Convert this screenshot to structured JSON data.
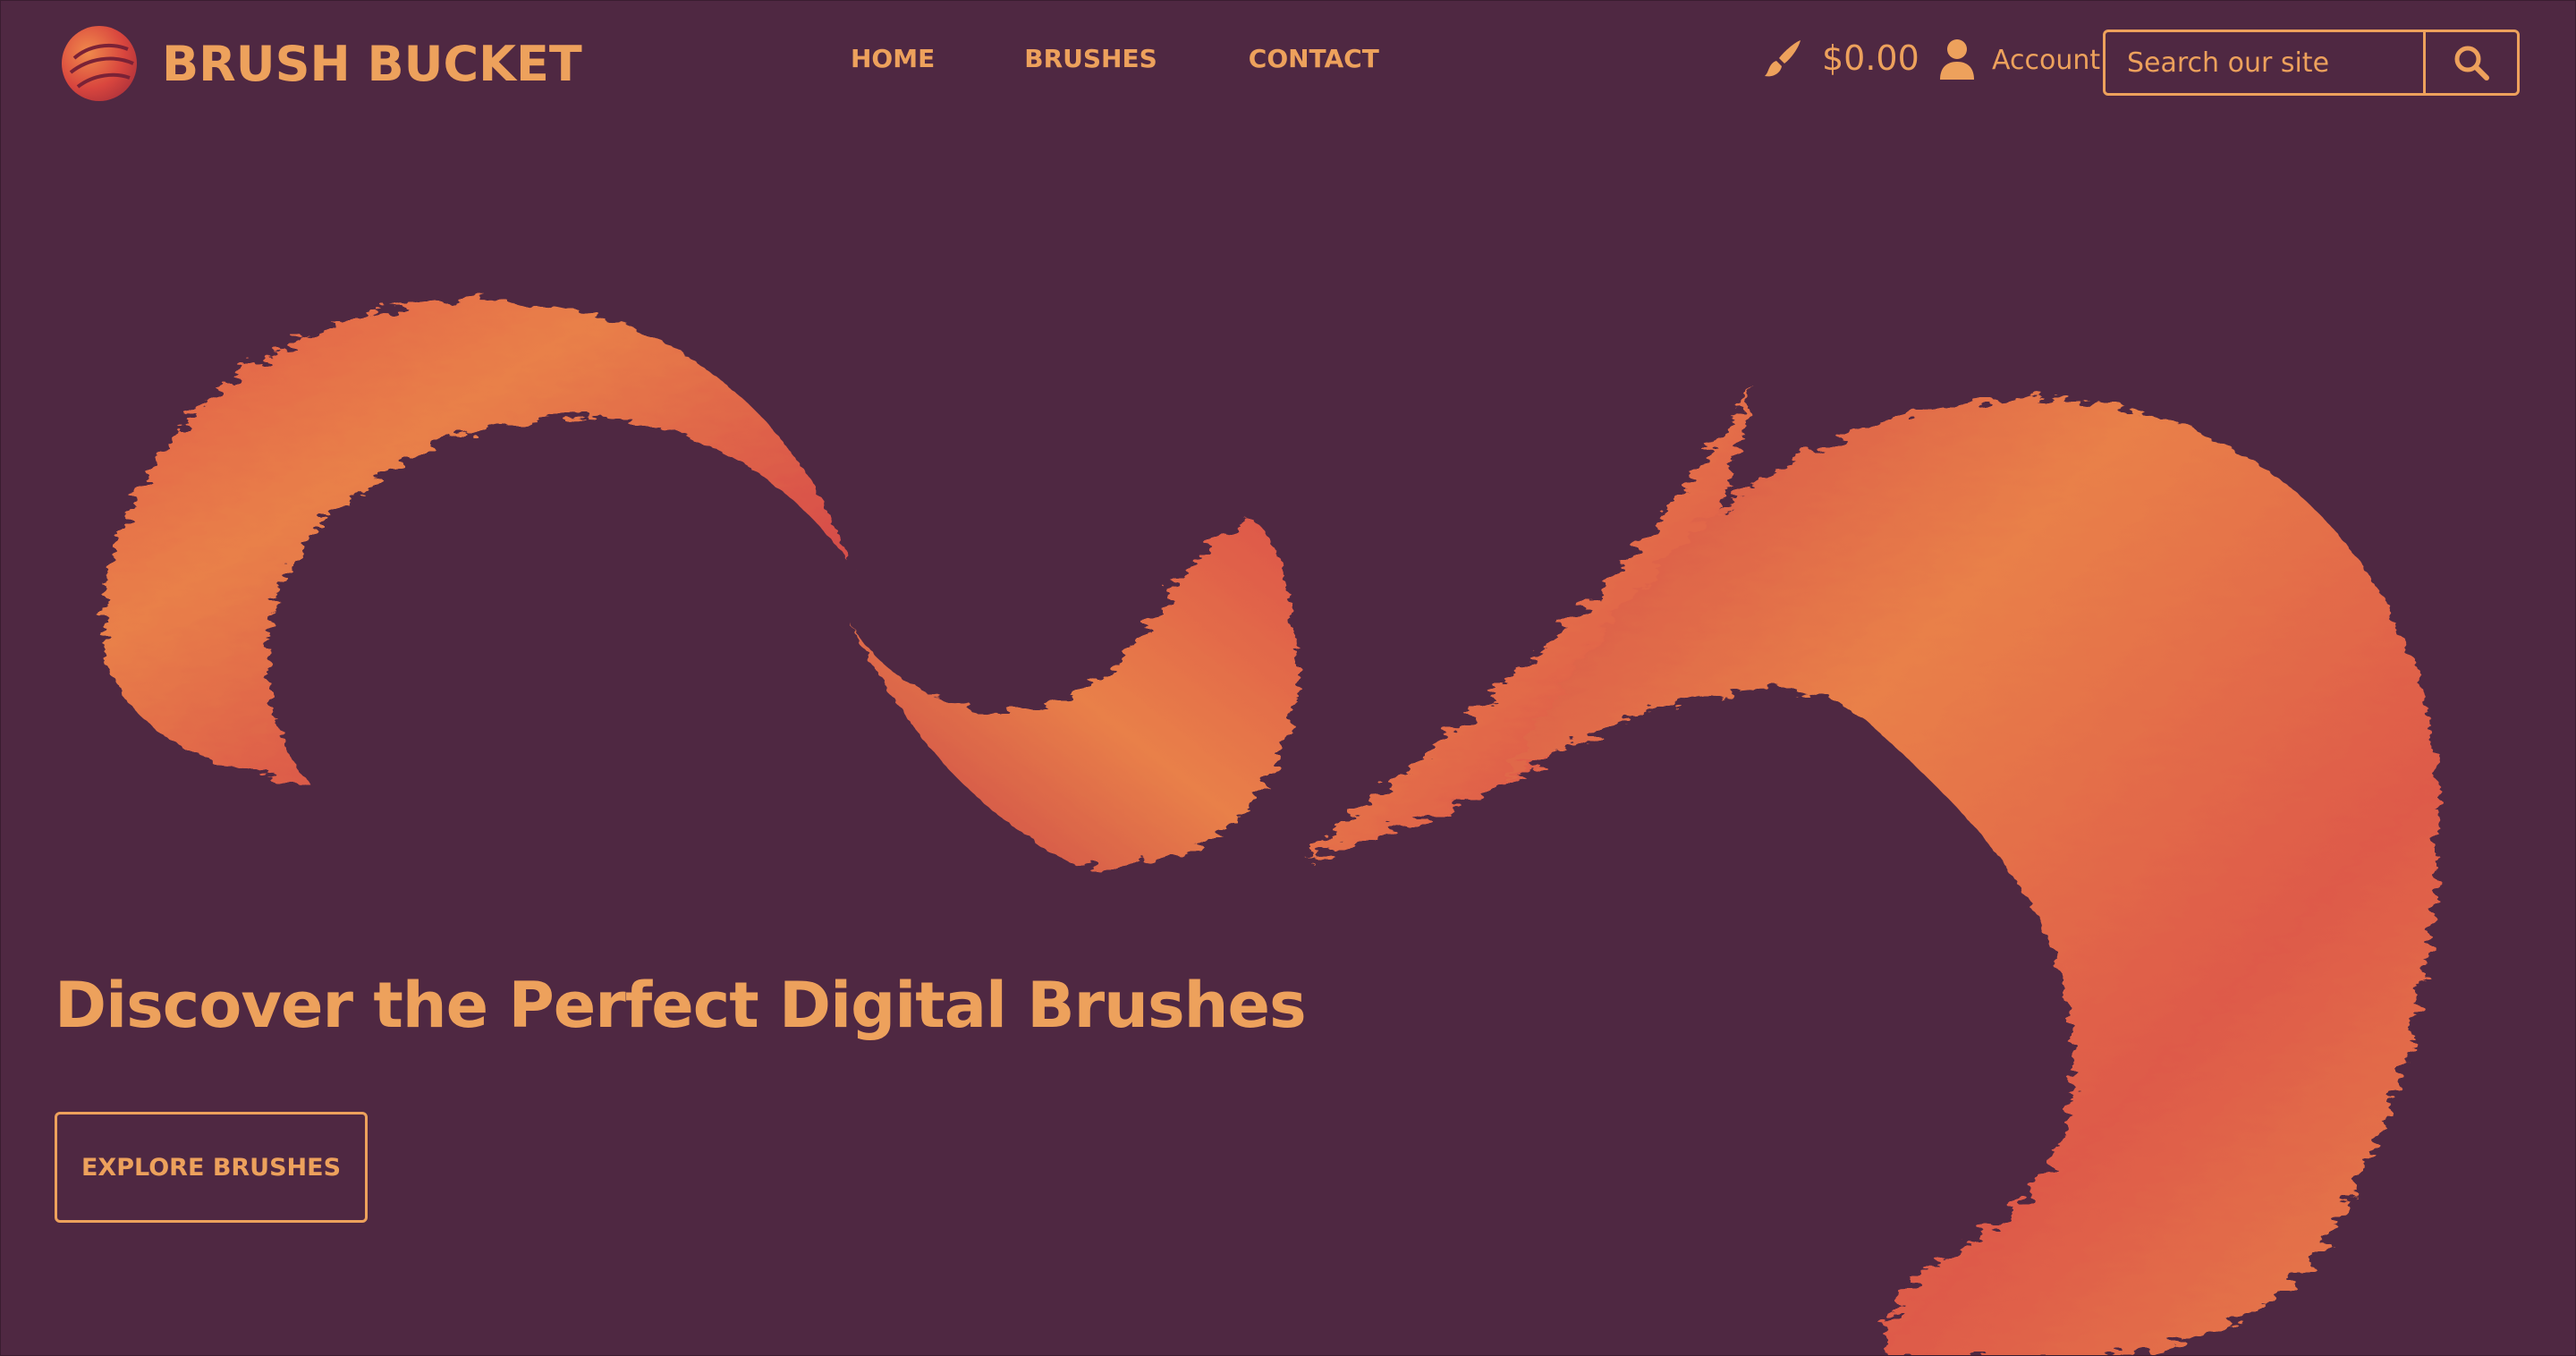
{
  "brand": {
    "name": "BRUSH BUCKET",
    "logo_icon": "paint-ball-logo-icon",
    "accent_color": "#eda15c",
    "background_color": "#4f2842"
  },
  "nav": {
    "items": [
      {
        "label": "HOME"
      },
      {
        "label": "BRUSHES"
      },
      {
        "label": "CONTACT"
      }
    ]
  },
  "cart": {
    "icon": "brush-icon",
    "amount": "$0.00"
  },
  "account": {
    "icon": "user-icon",
    "label": "Account"
  },
  "search": {
    "placeholder": "Search our site",
    "value": "",
    "icon": "search-icon"
  },
  "hero": {
    "title": "Discover the Perfect Digital Brushes",
    "cta_label": "EXPLORE BRUSHES",
    "art": "orange-red-brush-stroke-swirls",
    "gradient_colors": [
      "#e9804a",
      "#d9524a",
      "#c8404a"
    ]
  }
}
